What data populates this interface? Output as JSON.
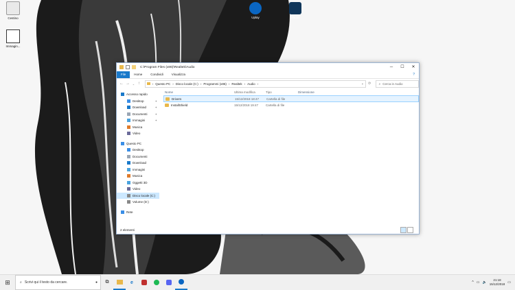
{
  "desktop": {
    "icons": [
      {
        "label": "Cestino",
        "name": "recycle-bin"
      },
      {
        "label": "Immagin...",
        "name": "image-shortcut"
      },
      {
        "label": "Uplay",
        "name": "uplay"
      },
      {
        "label": "Steam",
        "name": "steam"
      }
    ]
  },
  "window": {
    "title": "C:\\Program Files (x86)\\Realtek\\Audio",
    "ribbon_tabs": [
      "File",
      "Home",
      "Condividi",
      "Visualizza"
    ],
    "controls": {
      "minimize": "─",
      "maximize": "☐",
      "close": "✕"
    },
    "address": [
      "Questo PC",
      "Disco locale (C:)",
      "Programmi (x86)",
      "Realtek",
      "Audio"
    ],
    "search_placeholder": "Cerca in Audio",
    "columns": [
      "Nome",
      "Ultima modifica",
      "Tipo",
      "Dimensione"
    ],
    "files": [
      {
        "name": "Drivers",
        "modified": "15/12/2018 18:47",
        "type": "Cartella di file",
        "size": ""
      },
      {
        "name": "InstallShield",
        "modified": "15/12/2018 19:47",
        "type": "Cartella di file",
        "size": ""
      }
    ],
    "sidebar": [
      {
        "label": "Accesso rapido",
        "icon": "star-icon",
        "level": 0,
        "pinned": false,
        "selected": false
      },
      {
        "label": "Desktop",
        "icon": "desktop-icon",
        "level": 1,
        "pinned": true,
        "selected": false
      },
      {
        "label": "Download",
        "icon": "download-icon",
        "level": 1,
        "pinned": true,
        "selected": false
      },
      {
        "label": "Documenti",
        "icon": "documents-icon",
        "level": 1,
        "pinned": true,
        "selected": false
      },
      {
        "label": "Immagini",
        "icon": "pictures-icon",
        "level": 1,
        "pinned": true,
        "selected": false
      },
      {
        "label": "Musica",
        "icon": "music-icon",
        "level": 1,
        "pinned": false,
        "selected": false
      },
      {
        "label": "Video",
        "icon": "video-icon",
        "level": 1,
        "pinned": false,
        "selected": false
      },
      {
        "label": "",
        "icon": "",
        "level": -1,
        "pinned": false,
        "selected": false
      },
      {
        "label": "Questo PC",
        "icon": "pc-icon",
        "level": 0,
        "pinned": false,
        "selected": false
      },
      {
        "label": "Desktop",
        "icon": "desktop-icon",
        "level": 1,
        "pinned": false,
        "selected": false
      },
      {
        "label": "Documenti",
        "icon": "documents-icon",
        "level": 1,
        "pinned": false,
        "selected": false
      },
      {
        "label": "Download",
        "icon": "download-icon",
        "level": 1,
        "pinned": false,
        "selected": false
      },
      {
        "label": "Immagini",
        "icon": "pictures-icon",
        "level": 1,
        "pinned": false,
        "selected": false
      },
      {
        "label": "Musica",
        "icon": "music-icon",
        "level": 1,
        "pinned": false,
        "selected": false
      },
      {
        "label": "Oggetti 3D",
        "icon": "3d-objects-icon",
        "level": 1,
        "pinned": false,
        "selected": false
      },
      {
        "label": "Video",
        "icon": "video-icon",
        "level": 1,
        "pinned": false,
        "selected": false
      },
      {
        "label": "Disco locale (C:)",
        "icon": "drive-icon",
        "level": 1,
        "pinned": false,
        "selected": true
      },
      {
        "label": "Volume (D:)",
        "icon": "drive-icon",
        "level": 1,
        "pinned": false,
        "selected": false
      },
      {
        "label": "",
        "icon": "",
        "level": -1,
        "pinned": false,
        "selected": false
      },
      {
        "label": "Rete",
        "icon": "network-icon",
        "level": 0,
        "pinned": false,
        "selected": false
      }
    ],
    "status": "2 elementi"
  },
  "taskbar": {
    "search_placeholder": "Scrivi qui il testo da cercare.",
    "apps": [
      "task-view",
      "file-explorer",
      "edge",
      "app-red",
      "spotify",
      "discord",
      "uplay"
    ],
    "time": "21:18",
    "date": "15/12/2018"
  },
  "colors": {
    "accent": "#1979ca",
    "folder": "#e8b84b",
    "selection": "#cce8ff"
  }
}
